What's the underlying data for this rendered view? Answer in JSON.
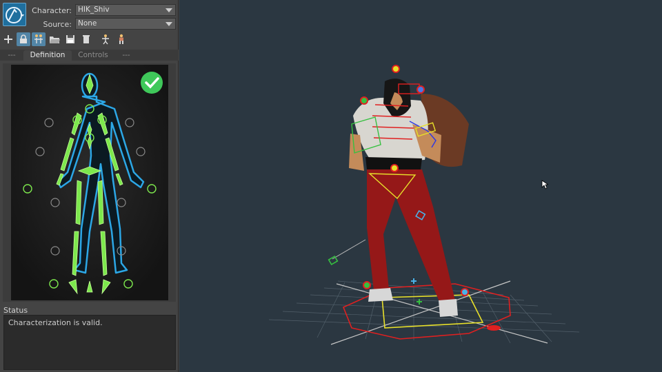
{
  "header": {
    "character_label": "Character:",
    "character_value": "HIK_Shiv",
    "source_label": "Source:",
    "source_value": "None"
  },
  "toolbar": {
    "icons": [
      "add-icon",
      "lock-icon",
      "mirror-icon",
      "folder-open-icon",
      "save-icon",
      "delete-icon",
      "skeleton-icon",
      "character-icon"
    ]
  },
  "tabs": [
    {
      "label": "---"
    },
    {
      "label": "Definition"
    },
    {
      "label": "Controls"
    },
    {
      "label": "---"
    }
  ],
  "definition": {
    "valid_badge": "check-icon"
  },
  "status": {
    "title": "Status",
    "message": "Characterization is valid."
  },
  "colors": {
    "accent": "#5285a6",
    "viewport_bg": "#2b3741",
    "valid_green": "#3fc85a",
    "effector_green": "#7de84d"
  }
}
